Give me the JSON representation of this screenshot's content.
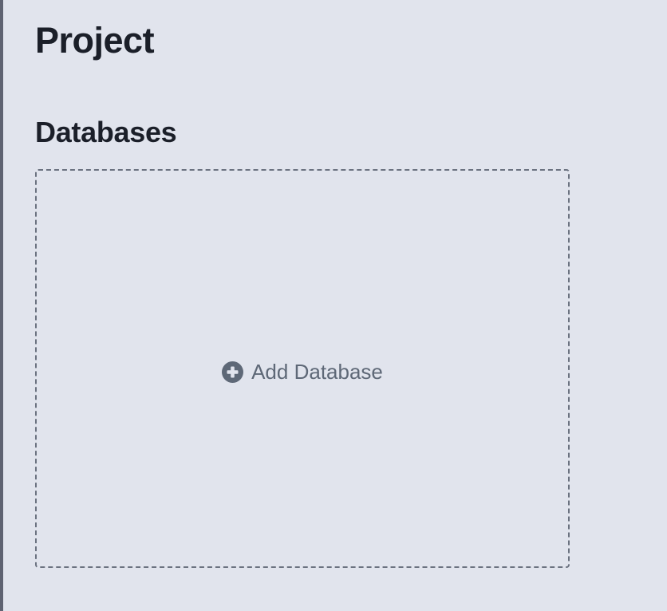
{
  "page": {
    "title": "Project"
  },
  "databases": {
    "heading": "Databases",
    "add_label": "Add Database"
  },
  "colors": {
    "background": "#e1e4ed",
    "text_dark": "#1b1f29",
    "muted": "#5e6877",
    "dashed_border": "#6b7280",
    "left_border": "#5f6372"
  },
  "icons": {
    "add": "plus-circle-icon"
  }
}
